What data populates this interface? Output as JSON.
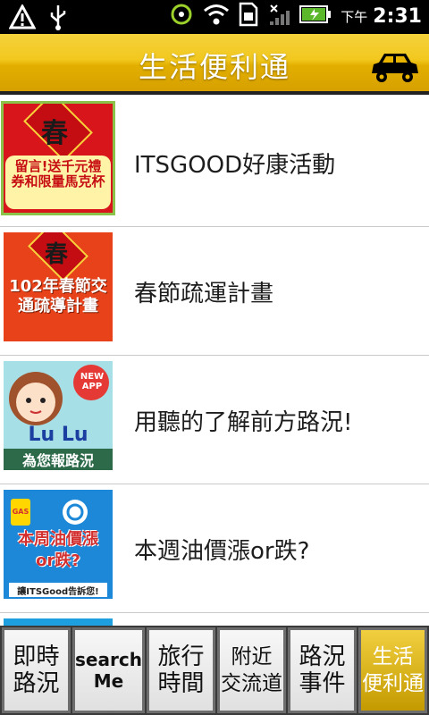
{
  "status": {
    "ampm": "下午",
    "time": "2:31"
  },
  "header": {
    "title": "生活便利通"
  },
  "list": [
    {
      "label": "ITSGOOD好康活動",
      "thumb": {
        "top": "春",
        "text": "留言!送千元禮券和限量馬克杯"
      }
    },
    {
      "label": "春節疏運計畫",
      "thumb": {
        "top": "春",
        "text": "102年春節交通疏導計畫"
      }
    },
    {
      "label": "用聽的了解前方路況!",
      "thumb": {
        "badge": "NEW APP",
        "name": "Lu Lu",
        "text": "為您報路況"
      }
    },
    {
      "label": "本週油價漲or跌?",
      "thumb": {
        "gas": "GAS",
        "text": "本周油價漲or跌?",
        "sub": "讓ITSGood告訴您!"
      }
    }
  ],
  "tabs": [
    {
      "l1": "即時",
      "l2": "路況"
    },
    {
      "l1": "search",
      "l2": "Me"
    },
    {
      "l1": "旅行",
      "l2": "時間"
    },
    {
      "l1": "附近",
      "l2": "交流道"
    },
    {
      "l1": "路況",
      "l2": "事件"
    },
    {
      "l1": "生活",
      "l2": "便利通"
    }
  ],
  "colors": {
    "accent": "#f2c81e",
    "selected": "#8bc34a"
  }
}
